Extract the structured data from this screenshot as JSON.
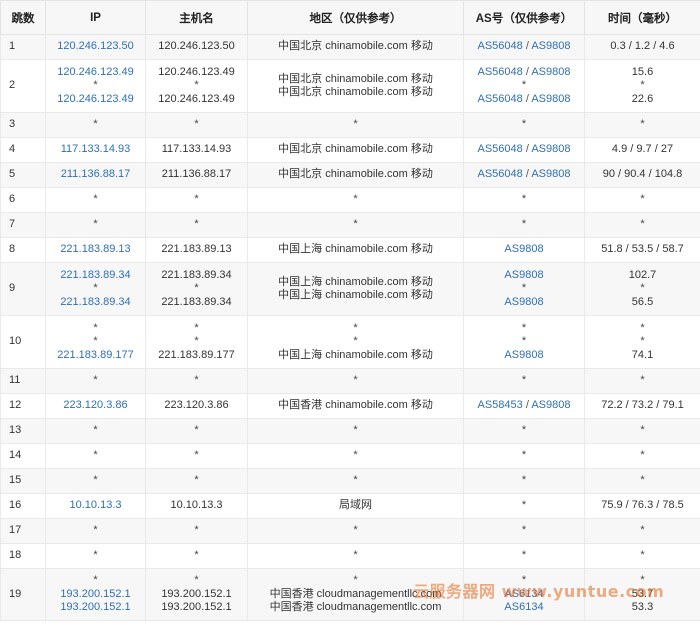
{
  "headers": [
    "跳数",
    "IP",
    "主机名",
    "地区（仅供参考）",
    "AS号（仅供参考）",
    "时间（毫秒）"
  ],
  "rows": [
    {
      "hop": "1",
      "lines": [
        {
          "ip": "120.246.123.50",
          "host": "120.246.123.50",
          "region": "中国北京 chinamobile.com 移动",
          "as": [
            "AS56048",
            "AS9808"
          ],
          "time": "0.3 / 1.2 / 4.6"
        }
      ]
    },
    {
      "hop": "2",
      "lines": [
        {
          "ip": "120.246.123.49",
          "host": "120.246.123.49",
          "region": "中国北京 chinamobile.com 移动",
          "as": [
            "AS56048",
            "AS9808"
          ],
          "time": "15.6"
        },
        {
          "ip": "*",
          "host": "*",
          "region": "",
          "as": [
            "*"
          ],
          "time": "*"
        },
        {
          "ip": "120.246.123.49",
          "host": "120.246.123.49",
          "region": "中国北京 chinamobile.com 移动",
          "as": [
            "AS56048",
            "AS9808"
          ],
          "time": "22.6"
        }
      ]
    },
    {
      "hop": "3",
      "lines": [
        {
          "ip": "*",
          "host": "*",
          "region": "*",
          "as": [
            "*"
          ],
          "time": "*"
        }
      ]
    },
    {
      "hop": "4",
      "lines": [
        {
          "ip": "117.133.14.93",
          "host": "117.133.14.93",
          "region": "中国北京 chinamobile.com 移动",
          "as": [
            "AS56048",
            "AS9808"
          ],
          "time": "4.9 / 9.7 / 27"
        }
      ]
    },
    {
      "hop": "5",
      "lines": [
        {
          "ip": "211.136.88.17",
          "host": "211.136.88.17",
          "region": "中国北京 chinamobile.com 移动",
          "as": [
            "AS56048",
            "AS9808"
          ],
          "time": "90 / 90.4 / 104.8"
        }
      ]
    },
    {
      "hop": "6",
      "lines": [
        {
          "ip": "*",
          "host": "*",
          "region": "*",
          "as": [
            "*"
          ],
          "time": "*"
        }
      ]
    },
    {
      "hop": "7",
      "lines": [
        {
          "ip": "*",
          "host": "*",
          "region": "*",
          "as": [
            "*"
          ],
          "time": "*"
        }
      ]
    },
    {
      "hop": "8",
      "lines": [
        {
          "ip": "221.183.89.13",
          "host": "221.183.89.13",
          "region": "中国上海 chinamobile.com 移动",
          "as": [
            "AS9808"
          ],
          "time": "51.8 / 53.5 / 58.7"
        }
      ]
    },
    {
      "hop": "9",
      "lines": [
        {
          "ip": "221.183.89.34",
          "host": "221.183.89.34",
          "region": "中国上海 chinamobile.com 移动",
          "as": [
            "AS9808"
          ],
          "time": "102.7"
        },
        {
          "ip": "*",
          "host": "*",
          "region": "",
          "as": [
            "*"
          ],
          "time": "*"
        },
        {
          "ip": "221.183.89.34",
          "host": "221.183.89.34",
          "region": "中国上海 chinamobile.com 移动",
          "as": [
            "AS9808"
          ],
          "time": "56.5"
        }
      ]
    },
    {
      "hop": "10",
      "lines": [
        {
          "ip": "*",
          "host": "*",
          "region": "*",
          "as": [
            "*"
          ],
          "time": "*"
        },
        {
          "ip": "*",
          "host": "*",
          "region": "*",
          "as": [
            "*"
          ],
          "time": "*"
        },
        {
          "ip": "221.183.89.177",
          "host": "221.183.89.177",
          "region": "中国上海 chinamobile.com 移动",
          "as": [
            "AS9808"
          ],
          "time": "74.1"
        }
      ]
    },
    {
      "hop": "11",
      "lines": [
        {
          "ip": "*",
          "host": "*",
          "region": "*",
          "as": [
            "*"
          ],
          "time": "*"
        }
      ]
    },
    {
      "hop": "12",
      "lines": [
        {
          "ip": "223.120.3.86",
          "host": "223.120.3.86",
          "region": "中国香港 chinamobile.com 移动",
          "as": [
            "AS58453",
            "AS9808"
          ],
          "time": "72.2 / 73.2 / 79.1"
        }
      ]
    },
    {
      "hop": "13",
      "lines": [
        {
          "ip": "*",
          "host": "*",
          "region": "*",
          "as": [
            "*"
          ],
          "time": "*"
        }
      ]
    },
    {
      "hop": "14",
      "lines": [
        {
          "ip": "*",
          "host": "*",
          "region": "*",
          "as": [
            "*"
          ],
          "time": "*"
        }
      ]
    },
    {
      "hop": "15",
      "lines": [
        {
          "ip": "*",
          "host": "*",
          "region": "*",
          "as": [
            "*"
          ],
          "time": "*"
        }
      ]
    },
    {
      "hop": "16",
      "lines": [
        {
          "ip": "10.10.13.3",
          "host": "10.10.13.3",
          "region": "局域网",
          "as": [
            "*"
          ],
          "time": "75.9 / 76.3 / 78.5"
        }
      ]
    },
    {
      "hop": "17",
      "lines": [
        {
          "ip": "*",
          "host": "*",
          "region": "*",
          "as": [
            "*"
          ],
          "time": "*"
        }
      ]
    },
    {
      "hop": "18",
      "lines": [
        {
          "ip": "*",
          "host": "*",
          "region": "*",
          "as": [
            "*"
          ],
          "time": "*"
        }
      ]
    },
    {
      "hop": "19",
      "lines": [
        {
          "ip": "*",
          "host": "*",
          "region": "*",
          "as": [
            "*"
          ],
          "time": "*"
        },
        {
          "ip": "193.200.152.1",
          "host": "193.200.152.1",
          "region": "中国香港 cloudmanagementllc.com",
          "as": [
            "AS6134"
          ],
          "time": "53.7"
        },
        {
          "ip": "193.200.152.1",
          "host": "193.200.152.1",
          "region": "中国香港 cloudmanagementllc.com",
          "as": [
            "AS6134"
          ],
          "time": "53.3"
        }
      ]
    }
  ],
  "watermark": "云服务器网 www.yuntue.com",
  "colors": {
    "link": "#2f6fb3",
    "header_bg": "#f7f7f7",
    "stripe": "#f7f7f7",
    "border": "#e4e4e4",
    "watermark": "#e56a1f"
  }
}
